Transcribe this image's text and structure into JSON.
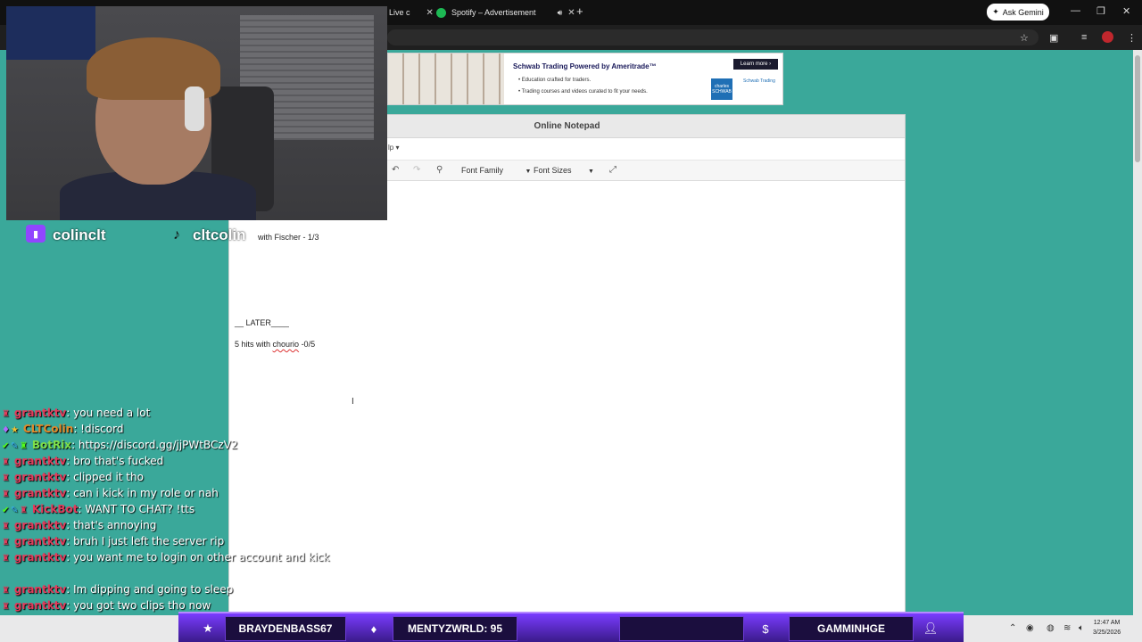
{
  "browser": {
    "tabs": [
      {
        "label": "Live c",
        "close": "✕"
      },
      {
        "label": "Spotify – Advertisement",
        "close": "✕"
      }
    ],
    "new_tab": "+",
    "ask_gemini": "Ask Gemini"
  },
  "ad": {
    "title": "Schwab Trading Powered by Ameritrade™",
    "line1": "• Education crafted for traders.",
    "line2": "• Trading courses and videos curated to fit your needs.",
    "learn_more": "Learn more ›",
    "logo1": "charles SCHWAB",
    "logo2": "Schwab Trading"
  },
  "notepad": {
    "title": "Online Notepad",
    "menu": "lp ▾",
    "font_family": "Font Family",
    "font_sizes": "Font Sizes",
    "lines": [
      "with Fischer - 1/3",
      "__ LATER____",
      "5 hits with chourio -0/5"
    ],
    "squiggle_word": "chourio"
  },
  "overlay": {
    "twitch_name": "colinclt",
    "tiktok_name": "cltcolin"
  },
  "chat": [
    {
      "user": "grantktv",
      "color": "#e33b5b",
      "msg": ": you need a lot"
    },
    {
      "user": "CLTColin",
      "color": "#e08a2c",
      "msg": ": !discord"
    },
    {
      "user": "BotRix",
      "color": "#7ee04a",
      "msg": ": https://discord.gg/jjPWtBCzV2"
    },
    {
      "user": "grantktv",
      "color": "#e33b5b",
      "msg": ": bro that's fucked"
    },
    {
      "user": "grantktv",
      "color": "#e33b5b",
      "msg": ": clipped it tho"
    },
    {
      "user": "grantktv",
      "color": "#e33b5b",
      "msg": ": can i kick in my role or nah"
    },
    {
      "user": "KickBot",
      "color": "#e33b5b",
      "msg": ": WANT TO CHAT? !tts"
    },
    {
      "user": "grantktv",
      "color": "#e33b5b",
      "msg": ": that's annoying"
    },
    {
      "user": "grantktv",
      "color": "#e33b5b",
      "msg": ": bruh I just left the server rip"
    },
    {
      "user": "grantktv",
      "color": "#e33b5b",
      "msg": ": you want me to login on other account and kick"
    },
    {
      "user": "grantktv",
      "color": "#e33b5b",
      "msg": ": Im dipping and going to sleep"
    },
    {
      "user": "grantktv",
      "color": "#e33b5b",
      "msg": ": you got two clips tho now"
    }
  ],
  "alerts": {
    "follower": "BRAYDENBASS67",
    "sub": "MENTYZWRLD: 95",
    "donation": "",
    "host": "GAMMINHGE"
  },
  "taskbar": {
    "time": "12:47 AM",
    "date": "3/25/2026"
  }
}
